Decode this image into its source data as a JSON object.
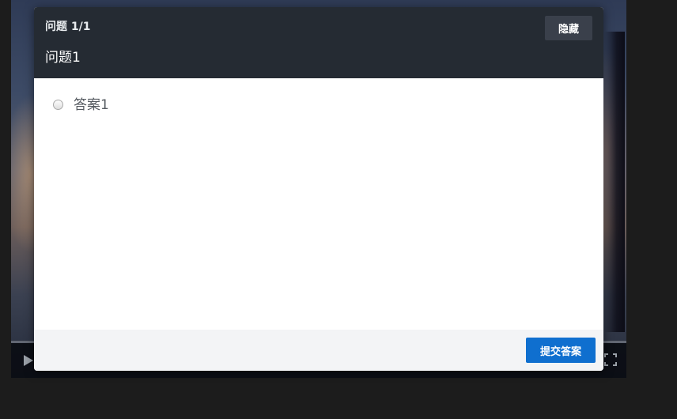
{
  "quiz": {
    "progress_label": "问题 1/1",
    "hide_label": "隐藏",
    "question_title": "问题1",
    "options": [
      {
        "label": "答案1",
        "selected": false
      }
    ],
    "submit_label": "提交答案"
  },
  "player": {
    "controls": [
      "play-icon",
      "fullscreen-icon"
    ]
  },
  "colors": {
    "header_bg": "#252b33",
    "hide_button_bg": "#3a404b",
    "submit_button_bg": "#0f6fcf",
    "footer_bg": "#f3f4f6"
  }
}
